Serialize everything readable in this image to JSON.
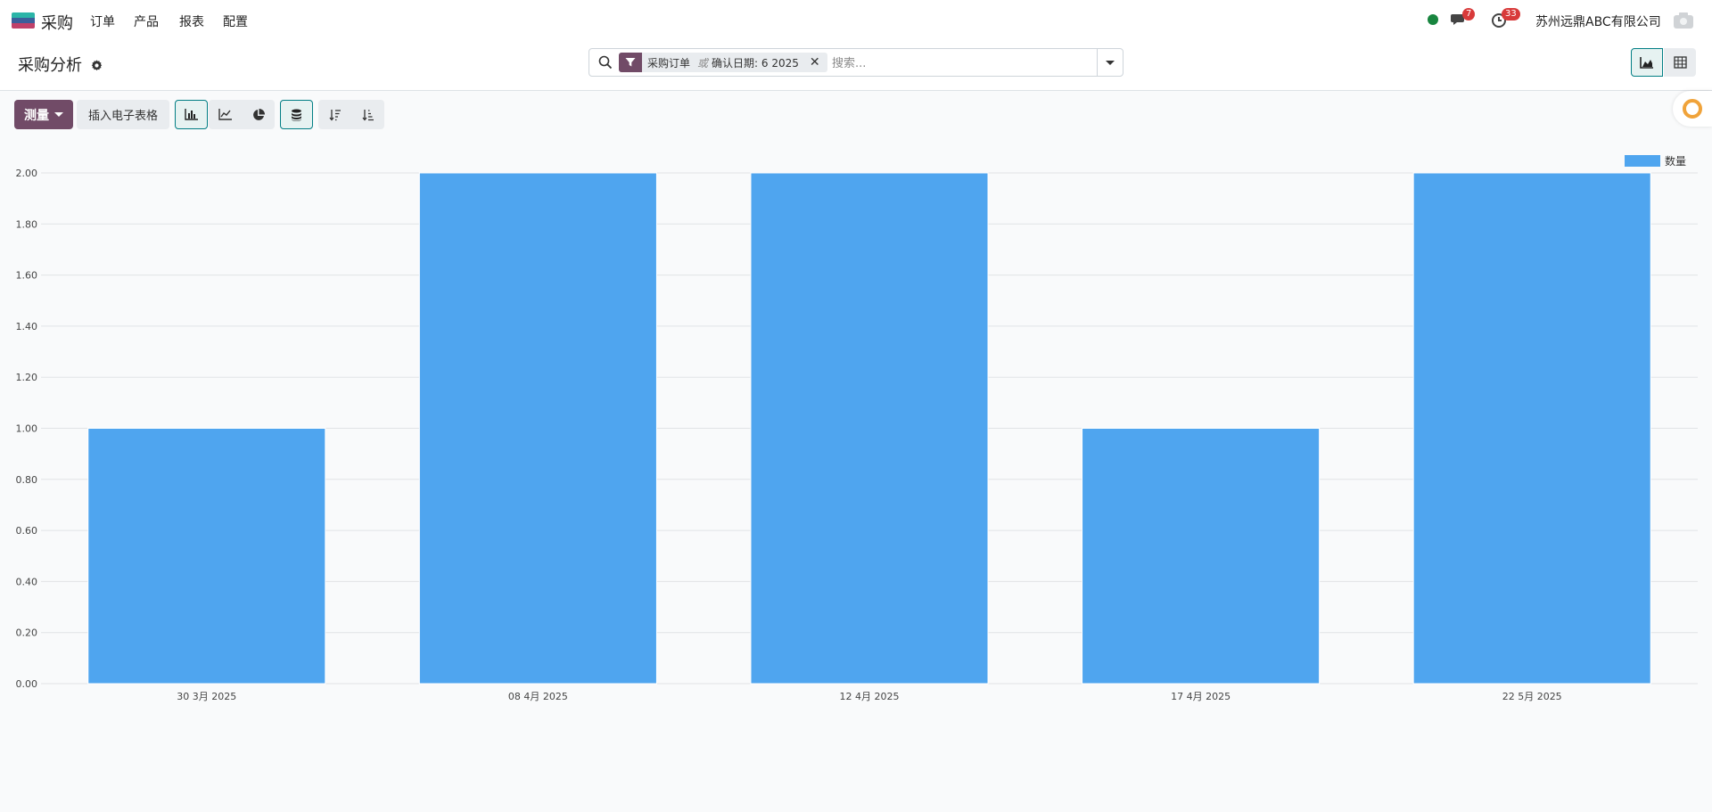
{
  "nav": {
    "app_name": "采购",
    "menu": [
      "订单",
      "产品",
      "报表",
      "配置"
    ],
    "messages_count": "7",
    "activities_count": "33",
    "company": "苏州远鼎ABC有限公司"
  },
  "control": {
    "title": "采购分析",
    "facet_part1": "采购订单",
    "facet_or": "或",
    "facet_part2": "确认日期: 6 2025",
    "search_placeholder": "搜索..."
  },
  "toolbar": {
    "measure_label": "测量",
    "insert_sheet_label": "插入电子表格"
  },
  "colors": {
    "brand": "#714b67",
    "accent": "#017e84",
    "bar": "#4fa5ef"
  },
  "chart_data": {
    "type": "bar",
    "categories": [
      "30 3月 2025",
      "08 4月 2025",
      "12 4月 2025",
      "17 4月 2025",
      "22 5月 2025"
    ],
    "series": [
      {
        "name": "数量",
        "values": [
          1,
          2,
          2,
          1,
          2
        ]
      }
    ],
    "ylim": [
      0,
      2
    ],
    "yticks": [
      "0.00",
      "0.20",
      "0.40",
      "0.60",
      "0.80",
      "1.00",
      "1.20",
      "1.40",
      "1.60",
      "1.80",
      "2.00"
    ],
    "grid": true,
    "legend": "top-right"
  }
}
